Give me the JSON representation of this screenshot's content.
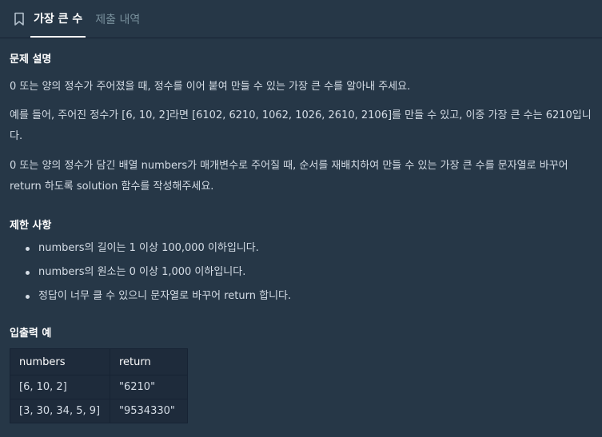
{
  "tabs": [
    {
      "label": "가장 큰 수"
    },
    {
      "label": "제출 내역"
    }
  ],
  "sections": {
    "description_title": "문제 설명",
    "desc_p1": "0 또는 양의 정수가 주어졌을 때, 정수를 이어 붙여 만들 수 있는 가장 큰 수를 알아내 주세요.",
    "desc_p2": "예를 들어, 주어진 정수가 [6, 10, 2]라면 [6102, 6210, 1062, 1026, 2610, 2106]를 만들 수 있고, 이중 가장 큰 수는 6210입니다.",
    "desc_p3": "0 또는 양의 정수가 담긴 배열 numbers가 매개변수로 주어질 때, 순서를 재배치하여 만들 수 있는 가장 큰 수를 문자열로 바꾸어 return 하도록 solution 함수를 작성해주세요.",
    "limits_title": "제한 사항",
    "limits": [
      "numbers의 길이는 1 이상 100,000 이하입니다.",
      "numbers의 원소는 0 이상 1,000 이하입니다.",
      "정답이 너무 클 수 있으니 문자열로 바꾸어 return 합니다."
    ],
    "examples_title": "입출력 예"
  },
  "examples_table": {
    "headers": [
      "numbers",
      "return"
    ],
    "rows": [
      [
        "[6, 10, 2]",
        "\"6210\""
      ],
      [
        "[3, 30, 34, 5, 9]",
        "\"9534330\""
      ]
    ]
  },
  "icons": {
    "bookmark": "bookmark-icon"
  }
}
